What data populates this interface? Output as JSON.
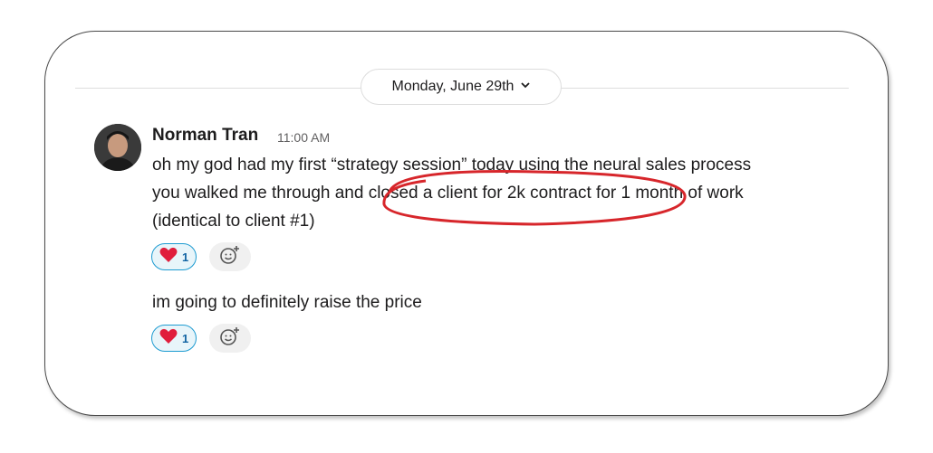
{
  "date_divider": {
    "label": "Monday, June 29th",
    "chevron": "chevron-down-icon"
  },
  "message": {
    "author": "Norman Tran",
    "timestamp": "11:00 AM",
    "lines": [
      "oh my god had my first “strategy session” today using the neural sales process",
      "you walked me through and closed a client for 2k contract for 1 month of work",
      "(identical to client #1)"
    ],
    "reaction": {
      "emoji": "heart-icon",
      "count": "1"
    },
    "followup": "im going to definitely raise the price",
    "followup_reaction": {
      "emoji": "heart-icon",
      "count": "1"
    }
  },
  "colors": {
    "annotation": "#d7262b",
    "reaction_border": "#1d9bd1",
    "heart": "#e01e3c"
  }
}
